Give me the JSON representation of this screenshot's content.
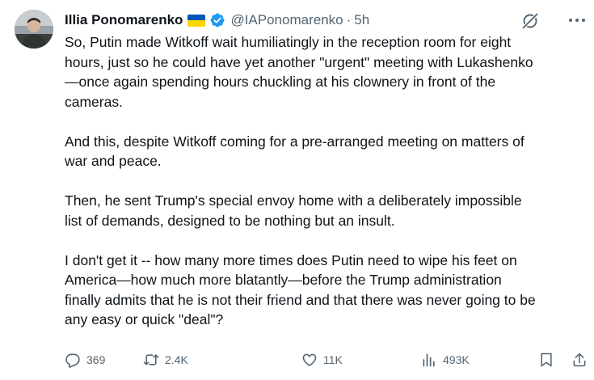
{
  "author": {
    "name": "Illia Ponomarenko",
    "handle": "@IAPonomarenko",
    "separator": "·",
    "time": "5h"
  },
  "icons": {
    "flag": "ukraine-flag-icon",
    "verified": "verified-badge-icon",
    "grok": "grok-icon",
    "more": "more-icon"
  },
  "colors": {
    "verified_blue": "#1d9bf0",
    "flag_blue": "#0057b7",
    "flag_yellow": "#ffd700",
    "secondary_text": "#536471"
  },
  "tweet": {
    "paragraphs": [
      "So, Putin made Witkoff wait humiliatingly in the reception room for eight\nhours, just so he could have yet another \"urgent\" meeting with Lukashenko\n—once again spending hours chuckling at his clownery in front of the\ncameras.",
      "And this, despite Witkoff coming for a pre-arranged meeting on matters of\nwar and peace.",
      "Then, he sent Trump's special envoy home with a deliberately impossible\nlist of demands, designed to be nothing but an insult.",
      "I don't get it -- how many more times does Putin need to wipe his feet on\nAmerica—how much more blatantly—before the Trump administration\nfinally admits that he is not their friend and that there was never going to be\nany easy or quick \"deal\"?"
    ]
  },
  "actions": {
    "replies": "369",
    "reposts": "2.4K",
    "likes": "11K",
    "views": "493K"
  }
}
